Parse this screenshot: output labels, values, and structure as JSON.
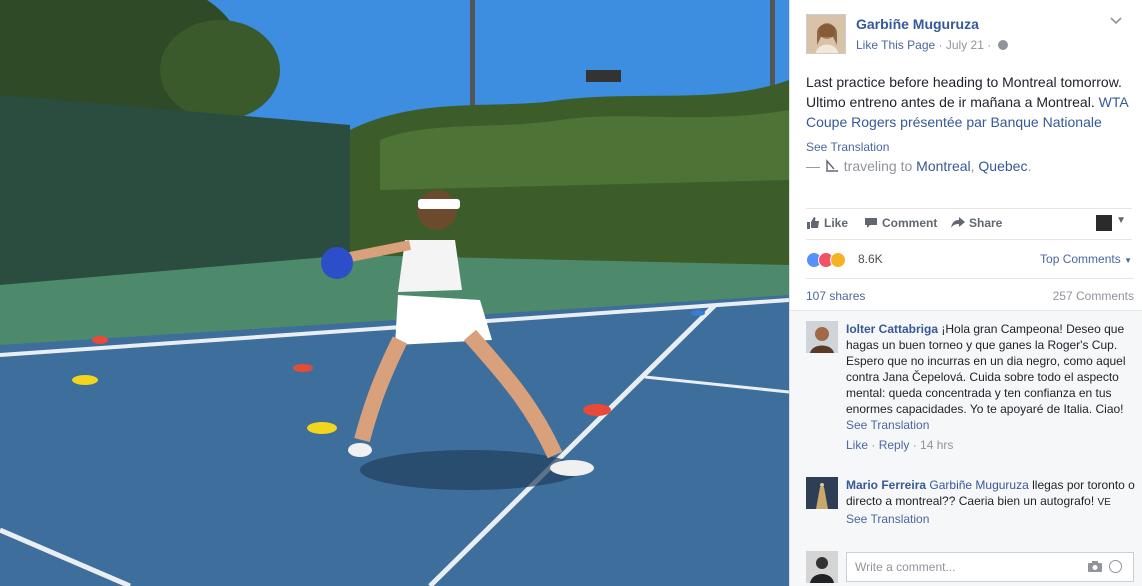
{
  "post": {
    "page_name": "Garbiñe Muguruza",
    "like_page": "Like This Page",
    "dot": "·",
    "date": "July 21",
    "text_line1": "Last practice before heading to Montreal tomorrow.",
    "text_line2": "Ultimo entreno antes de ir mañana a Montreal.",
    "text_link": "WTA Coupe Rogers présentée par Banque Nationale",
    "see_translation": "See Translation",
    "traveling_prefix": "—",
    "traveling_text": "traveling to",
    "place_city": "Montreal",
    "place_sep": ",",
    "place_region": "Quebec",
    "place_end": "."
  },
  "actions": {
    "like": "Like",
    "comment": "Comment",
    "share": "Share"
  },
  "reactions": {
    "count": "8.6K",
    "top_comments": "Top Comments",
    "colors": {
      "like": "#5890ff",
      "love": "#f25268",
      "wow": "#f7b125"
    }
  },
  "stats": {
    "shares": "107 shares",
    "comments": "257 Comments"
  },
  "comments": [
    {
      "author": "Iolter Cattabriga",
      "text": "¡Hola gran Campeona! Deseo que hagas un buen torneo y que ganes la Roger's Cup. Espero que no incurras en un dia negro, como aquel contra Jana Čepelová. Cuida sobre todo el aspecto mental: queda concentrada y ten confianza en tus enormes capacidades. Yo te apoyaré de Italia. Ciao!",
      "see_translation": "See Translation",
      "like": "Like",
      "reply": "Reply",
      "time": "14 hrs"
    },
    {
      "author": "Mario Ferreira",
      "mention": "Garbiñe Muguruza",
      "text": "llegas por toronto o directo a montreal?? Caeria bien un autografo!",
      "suffix": "VE",
      "see_translation": "See Translation"
    }
  ],
  "composer": {
    "placeholder": "Write a comment..."
  },
  "icons": [
    "chevron-down-icon",
    "globe-icon",
    "plane-icon",
    "like-icon",
    "comment-icon",
    "share-icon",
    "camera-icon",
    "emoji-icon"
  ]
}
